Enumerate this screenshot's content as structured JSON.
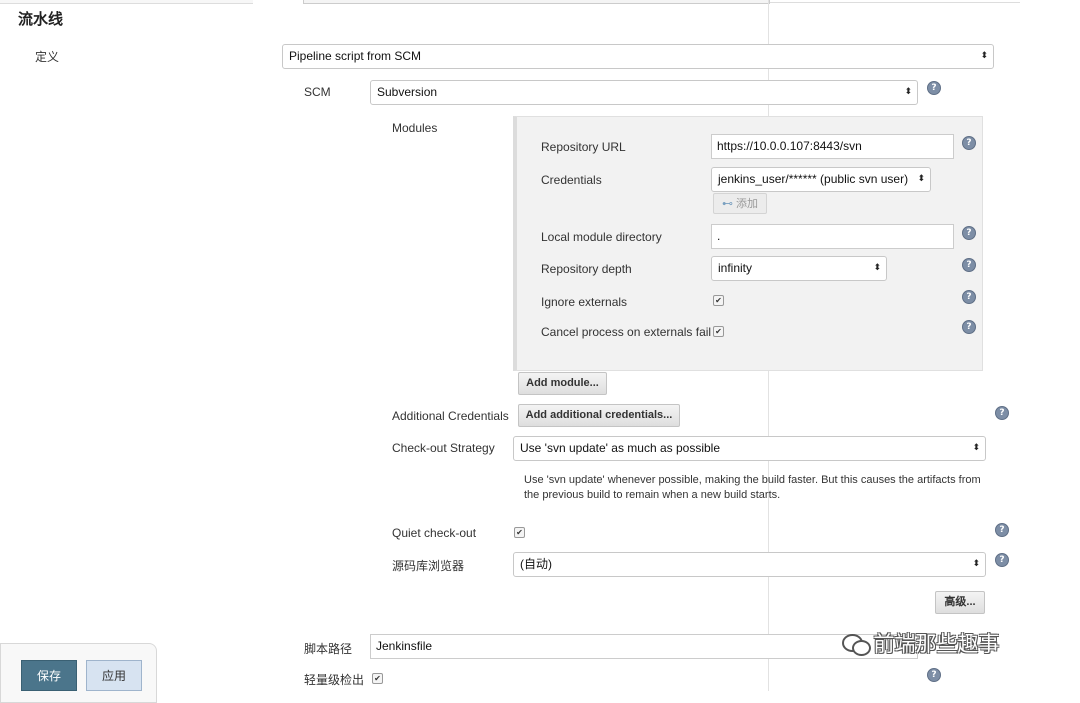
{
  "section_title": "流水线",
  "definition": {
    "label": "定义",
    "value": "Pipeline script from SCM"
  },
  "scm": {
    "label": "SCM",
    "value": "Subversion"
  },
  "modules": {
    "label": "Modules",
    "repository_url": {
      "label": "Repository URL",
      "value": "https://10.0.0.107:8443/svn"
    },
    "credentials": {
      "label": "Credentials",
      "value": "jenkins_user/****** (public svn user)",
      "add_button": "添加"
    },
    "local_module_directory": {
      "label": "Local module directory",
      "value": "."
    },
    "repository_depth": {
      "label": "Repository depth",
      "value": "infinity"
    },
    "ignore_externals": {
      "label": "Ignore externals",
      "checked": true
    },
    "cancel_process": {
      "label": "Cancel process on externals fail",
      "checked": true
    },
    "add_module_button": "Add module..."
  },
  "additional_credentials": {
    "label": "Additional Credentials",
    "button": "Add additional credentials..."
  },
  "checkout_strategy": {
    "label": "Check-out Strategy",
    "value": "Use 'svn update' as much as possible",
    "description_line1": "Use 'svn update' whenever possible, making the build faster. But this causes the artifacts from",
    "description_line2": "the previous build to remain when a new build starts."
  },
  "quiet_checkout": {
    "label": "Quiet check-out",
    "checked": true
  },
  "repo_browser": {
    "label": "源码库浏览器",
    "value": "(自动)"
  },
  "advanced_button": "高级...",
  "script_path": {
    "label": "脚本路径",
    "value": "Jenkinsfile"
  },
  "lightweight_checkout": {
    "label": "轻量级检出",
    "checked": true
  },
  "footer": {
    "save": "保存",
    "apply": "应用"
  },
  "watermark": "前端那些趣事",
  "icons": {
    "help": "?",
    "select_arrow": "⬍",
    "check": "✔",
    "key": "key-icon"
  },
  "colors": {
    "primary_button": "#4b758b",
    "help_icon": "#7d8ea6"
  }
}
